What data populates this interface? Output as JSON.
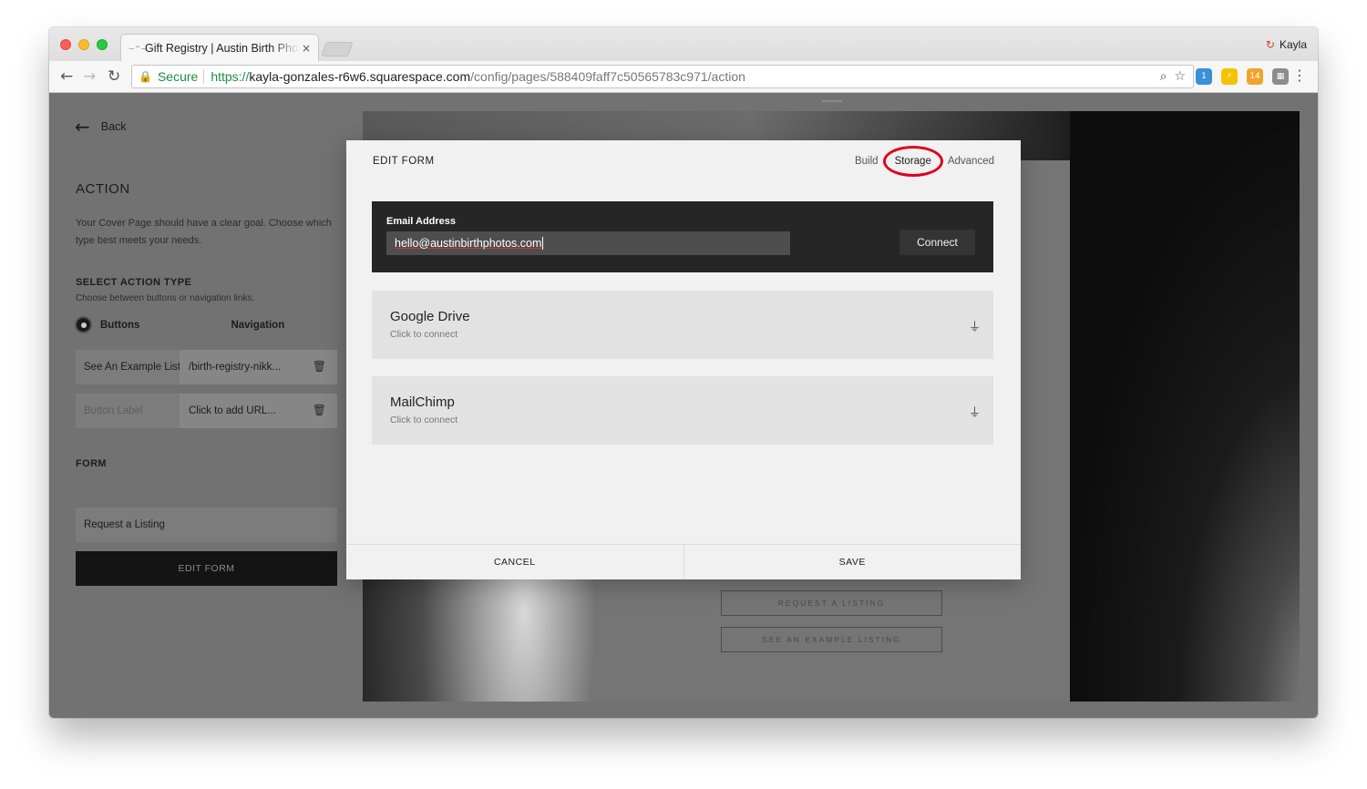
{
  "browser": {
    "tab_favicon": "~^~",
    "tab_title": "Gift Registry | Austin Birth Photos",
    "tab_close": "×",
    "profile_name": "Kayla",
    "profile_icon": "↻",
    "back_glyph": "←",
    "forward_glyph": "→",
    "reload_glyph": "↻",
    "lock_glyph": "🔒",
    "secure_label": "Secure",
    "url_scheme": "https://",
    "url_host": "kayla-gonzales-r6w6.squarespace.com",
    "url_path": "/config/pages/588409faff7c50565783c971/action",
    "zoom_glyph": "⌕",
    "star_glyph": "☆",
    "menu_glyph": "⋮",
    "extensions": [
      {
        "name": "translate-extension",
        "glyph": "1",
        "color": "#3b8fd6"
      },
      {
        "name": "bolt-extension",
        "glyph": "⚡",
        "color": "#f3c300"
      },
      {
        "name": "calendar-extension",
        "glyph": "14",
        "color": "#f0a32b"
      },
      {
        "name": "grid-extension",
        "glyph": "▦",
        "color": "#8c8c8c"
      }
    ]
  },
  "sidebar": {
    "back_arrow": "←",
    "back_label": "Back",
    "title": "ACTION",
    "description": "Your Cover Page should have a clear goal. Choose which type best meets your needs.",
    "action_type_label": "SELECT ACTION TYPE",
    "action_type_sub": "Choose between buttons or navigation links.",
    "option_buttons": "Buttons",
    "option_navigation": "Navigation",
    "links": [
      {
        "label": "See An Example Listing",
        "url": "/birth-registry-nikk..."
      },
      {
        "label": "",
        "label_placeholder": "Button Label",
        "url": "Click to add URL..."
      }
    ],
    "trash_glyph": "🗑",
    "form_label": "FORM",
    "form_value": "Request a Listing",
    "edit_form_button": "EDIT FORM"
  },
  "preview": {
    "buttons": [
      "REQUEST A LISTING",
      "SEE AN EXAMPLE LISTING"
    ]
  },
  "modal": {
    "title": "EDIT FORM",
    "tabs": {
      "build": "Build",
      "storage": "Storage",
      "advanced": "Advanced"
    },
    "active_tab": "Storage",
    "highlight_color": "#e0001b",
    "email_label": "Email Address",
    "email_value": "hello@austinbirthphotos.com",
    "connect_button": "Connect",
    "storage_options": [
      {
        "name": "Google Drive",
        "status": "Click to connect"
      },
      {
        "name": "MailChimp",
        "status": "Click to connect"
      }
    ],
    "plug_glyph": "⏚",
    "cancel_button": "CANCEL",
    "save_button": "SAVE"
  }
}
